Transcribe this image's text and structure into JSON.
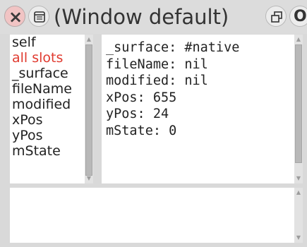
{
  "window": {
    "title": "(Window default)"
  },
  "titlebar": {
    "close_glyph": "×",
    "expand_glyph": "O",
    "icons": [
      "close-icon",
      "menu-icon",
      "collapse-icon",
      "expand-icon"
    ]
  },
  "slots": {
    "items": [
      {
        "label": "self"
      },
      {
        "label": "all slots",
        "selected": true
      },
      {
        "label": "_surface"
      },
      {
        "label": "fileName"
      },
      {
        "label": "modified"
      },
      {
        "label": "xPos"
      },
      {
        "label": "yPos"
      },
      {
        "label": "mState"
      }
    ]
  },
  "inspector": {
    "lines": [
      "_surface: #native",
      "fileName: nil",
      "modified: nil",
      "xPos: 655",
      "yPos: 24",
      "mState: 0"
    ]
  },
  "code": {
    "text": ""
  },
  "colors": {
    "selected_text": "#e03a2f",
    "close_button_fill": "#f1c4c4",
    "chrome": "#d9d9d9"
  }
}
